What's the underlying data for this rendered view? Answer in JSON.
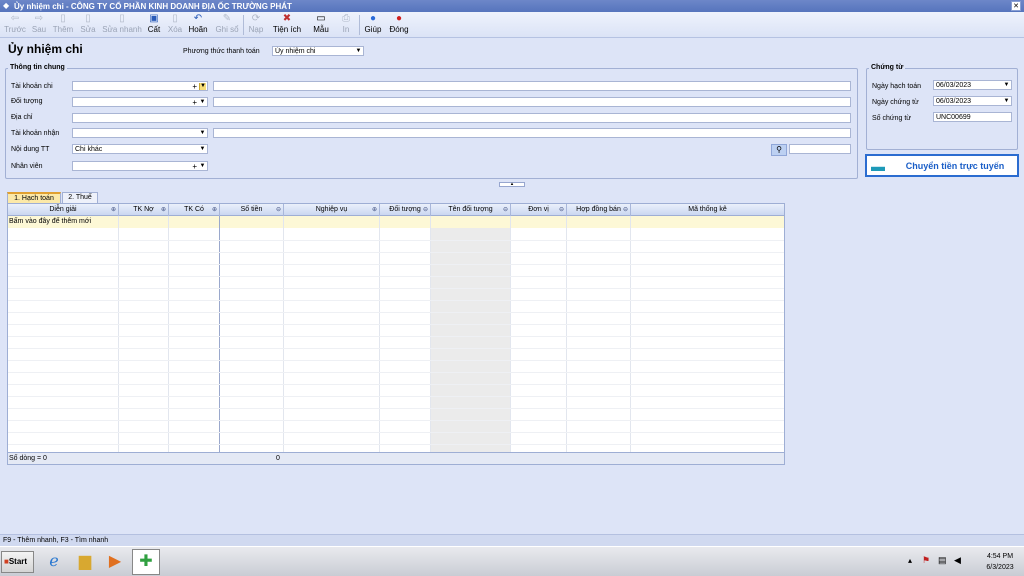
{
  "window": {
    "title": "Ủy nhiệm chi - CÔNG TY CỔ PHẦN KINH DOANH ĐỊA ỐC TRƯỜNG PHÁT"
  },
  "toolbar": {
    "items": [
      {
        "label": "Trước",
        "icon": "arrow-left-icon",
        "enabled": false
      },
      {
        "label": "Sau",
        "icon": "arrow-right-icon",
        "enabled": false
      },
      {
        "label": "Thêm",
        "icon": "add-document-icon",
        "enabled": false
      },
      {
        "label": "Sửa",
        "icon": "edit-document-icon",
        "enabled": false
      },
      {
        "label": "Sửa nhanh",
        "icon": "quick-edit-icon",
        "enabled": false
      },
      {
        "label": "Cất",
        "icon": "save-icon",
        "enabled": true
      },
      {
        "label": "Xóa",
        "icon": "delete-icon",
        "enabled": false
      },
      {
        "label": "Hoãn",
        "icon": "undo-icon",
        "enabled": true
      },
      {
        "label": "Ghi sổ",
        "icon": "pencil-icon",
        "enabled": false
      },
      {
        "label": "Nạp",
        "icon": "refresh-icon",
        "enabled": false
      },
      {
        "label": "Tiện ích",
        "icon": "tools-icon",
        "enabled": true
      },
      {
        "label": "Mẫu",
        "icon": "template-icon",
        "enabled": true
      },
      {
        "label": "In",
        "icon": "printer-icon",
        "enabled": false
      },
      {
        "label": "Giúp",
        "icon": "help-icon",
        "enabled": true
      },
      {
        "label": "Đóng",
        "icon": "close-icon",
        "enabled": true
      }
    ]
  },
  "form": {
    "title": "Ủy nhiệm chi",
    "payment_method_label": "Phương thức thanh toán",
    "payment_method_value": "Ủy nhiệm chi",
    "general": {
      "title": "Thông tin chung",
      "account_label": "Tài khoản chi",
      "subject_label": "Đối tượng",
      "address_label": "Địa chỉ",
      "receiver_account_label": "Tài khoản nhận",
      "content_label": "Nội dung TT",
      "content_value": "Chi khác",
      "employee_label": "Nhân viên"
    },
    "voucher": {
      "title": "Chứng từ",
      "posting_date_label": "Ngày hạch toán",
      "posting_date_value": "06/03/2023",
      "voucher_date_label": "Ngày chứng từ",
      "voucher_date_value": "06/03/2023",
      "voucher_no_label": "Số chứng từ",
      "voucher_no_value": "UNC00699"
    },
    "online_transfer_label": "Chuyển tiền trực tuyến"
  },
  "tabs": [
    {
      "label": "1. Hạch toán",
      "active": true
    },
    {
      "label": "2. Thuế",
      "active": false
    }
  ],
  "grid": {
    "columns": [
      "Diễn giải",
      "TK Nợ",
      "TK Có",
      "Số tiền",
      "Nghiệp vụ",
      "Đối tượng",
      "Tên đối tượng",
      "Đơn vị",
      "Hợp đồng bán",
      "Mã thống kê"
    ],
    "new_row_text": "Bấm vào đây để thêm mới",
    "row_count_text": "Số dòng = 0",
    "total_amount": "0"
  },
  "statusbar": {
    "text": "F9 - Thêm nhanh, F3 - Tìm nhanh"
  },
  "taskbar": {
    "start_label": "Start",
    "time": "4:54 PM",
    "date": "6/3/2023"
  }
}
